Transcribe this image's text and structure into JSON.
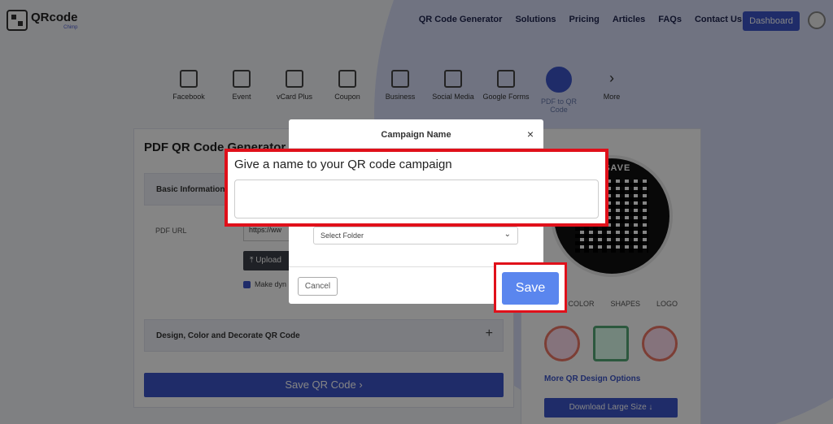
{
  "header": {
    "logo_text": "QRcode",
    "logo_sub": "Chimp",
    "nav": [
      "QR Code Generator",
      "Solutions",
      "Pricing",
      "Articles",
      "FAQs",
      "Contact Us"
    ],
    "dashboard_label": "Dashboard"
  },
  "categories": [
    {
      "label": "Facebook",
      "icon": "thumbs-up-icon"
    },
    {
      "label": "Event",
      "icon": "calendar-icon"
    },
    {
      "label": "vCard Plus",
      "icon": "contact-card-icon"
    },
    {
      "label": "Coupon",
      "icon": "coupon-icon"
    },
    {
      "label": "Business",
      "icon": "building-icon"
    },
    {
      "label": "Social Media",
      "icon": "share-icon"
    },
    {
      "label": "Google Forms",
      "icon": "form-icon"
    },
    {
      "label": "PDF to QR Code",
      "icon": "pdf-icon"
    },
    {
      "label": "More",
      "icon": "chevron-right-icon"
    }
  ],
  "form": {
    "title": "PDF QR Code Generator",
    "basic_info": "Basic Information",
    "pdf_url_label": "PDF URL",
    "pdf_url_value": "https://ww",
    "upload_label": "⤒  Upload",
    "dynamic_label": "Make dyn",
    "design_section": "Design, Color and Decorate QR Code",
    "expand_icon": "+",
    "save_qr_label": "Save QR Code ›"
  },
  "preview": {
    "ring_text": "O SAVE",
    "tabs": [
      "COLOR",
      "SHAPES",
      "LOGO"
    ],
    "more_options": "More QR Design Options",
    "download_label": "Download Large Size ↓"
  },
  "modal": {
    "title": "Campaign Name",
    "close_glyph": "×",
    "name_prompt": "Give a name to your QR code campaign",
    "name_value": "",
    "folder_placeholder": "Select Folder",
    "folder_chevron": "⌄",
    "cancel_label": "Cancel",
    "save_label": "Save"
  },
  "colors": {
    "accent": "#3c55c9",
    "highlight": "#e0101a",
    "save_button": "#5a86ee"
  }
}
